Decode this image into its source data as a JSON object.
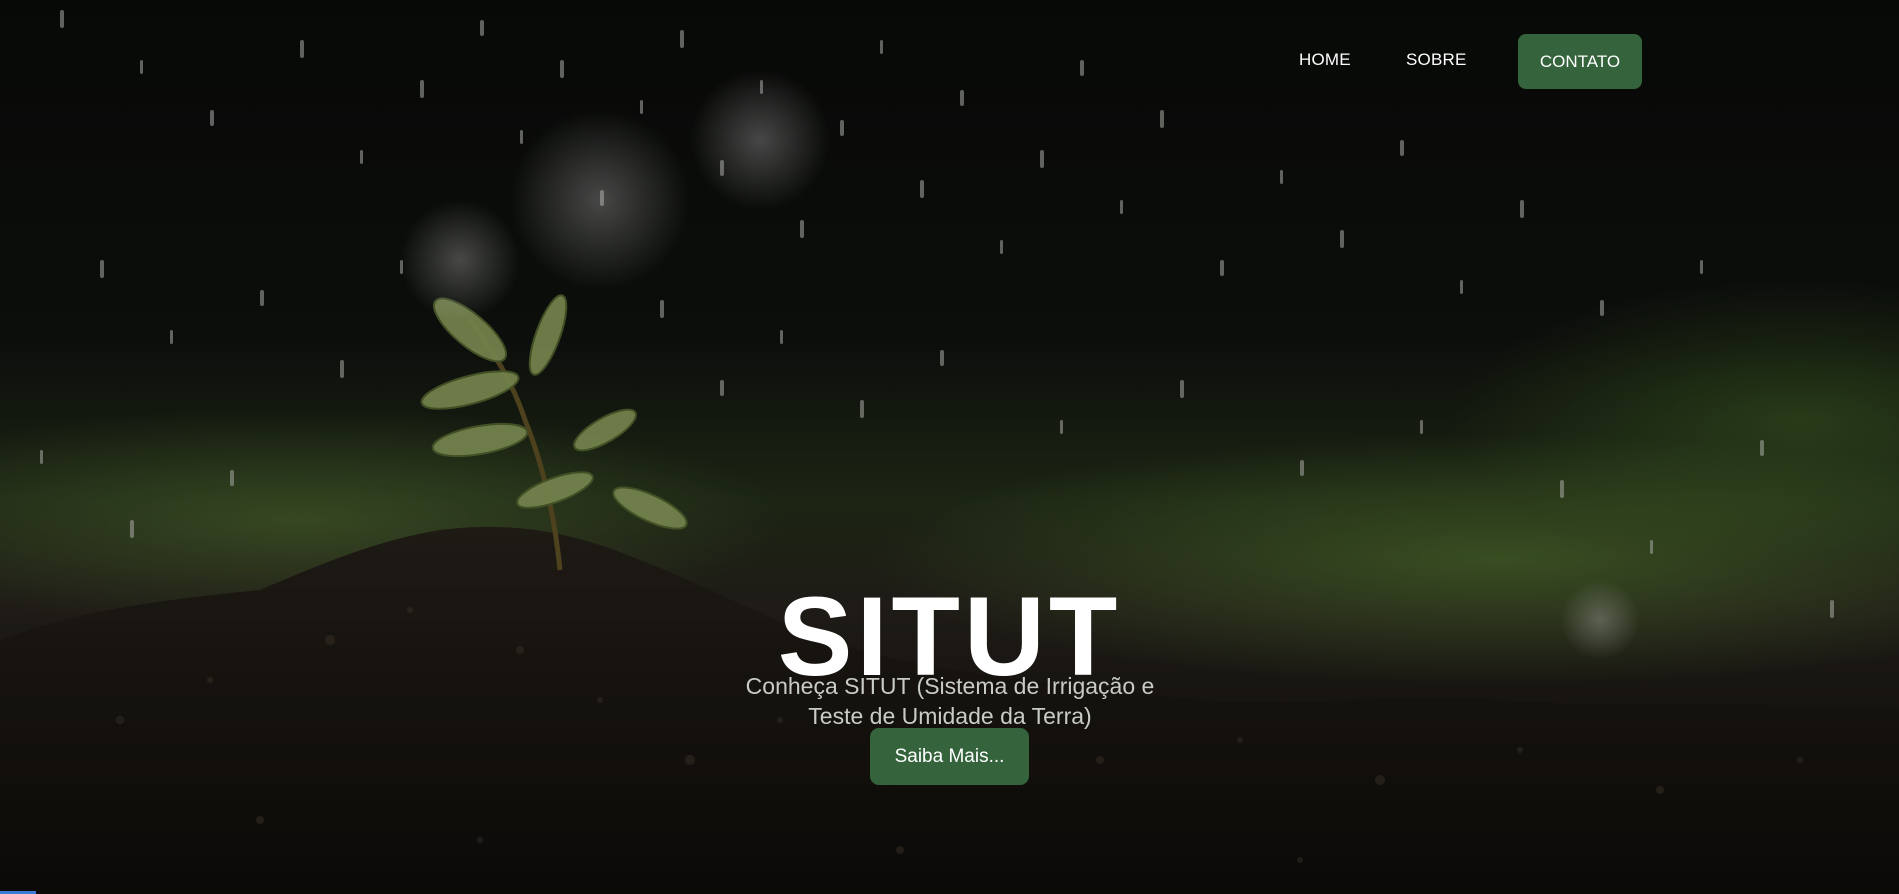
{
  "nav": {
    "items": [
      {
        "label": "HOME"
      },
      {
        "label": "SOBRE"
      }
    ],
    "cta_label": "CONTATO"
  },
  "hero": {
    "title": "SITUT",
    "subtitle": "Conheça SITUT (Sistema de Irrigação e Teste de Umidade da Terra)",
    "button_label": "Saiba Mais..."
  },
  "colors": {
    "accent": "#35633c",
    "title": "#ffffff",
    "subtitle": "#c9cbc6"
  },
  "background": {
    "subject": "seedling sprouting from soil under falling water droplets"
  }
}
